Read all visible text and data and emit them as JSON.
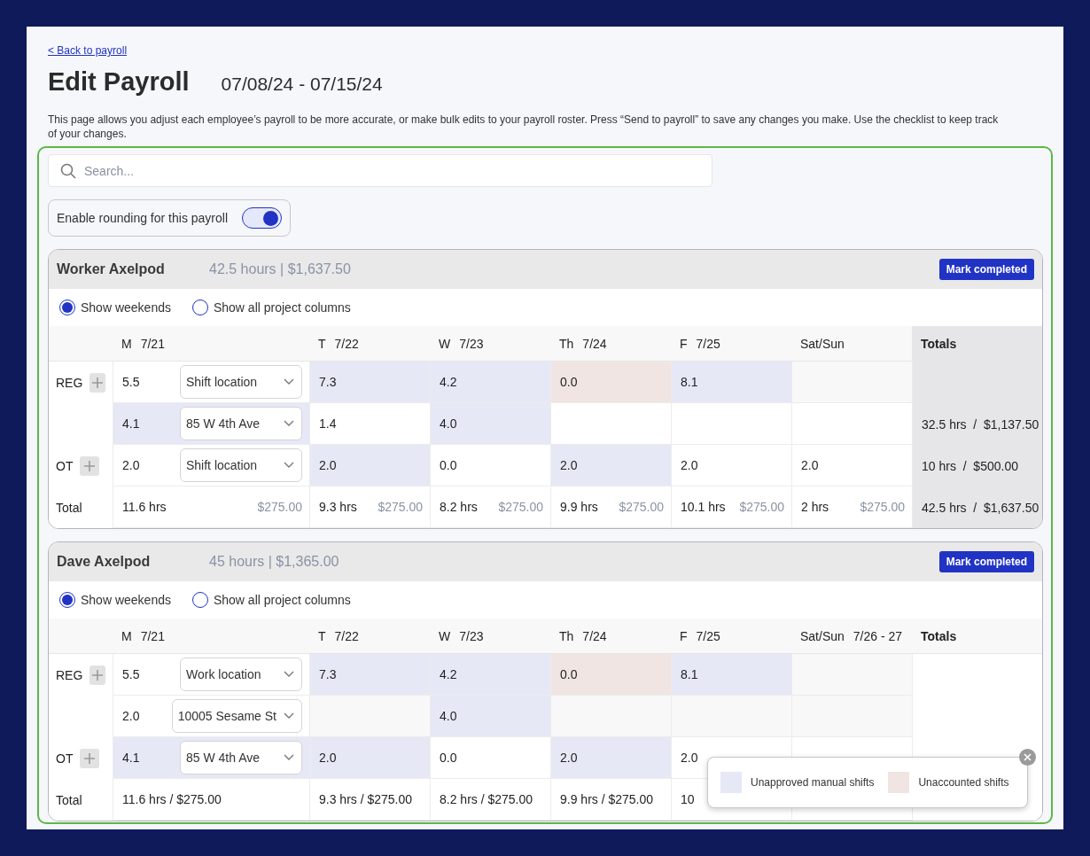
{
  "back_link": "< Back to payroll",
  "title": "Edit Payroll",
  "date_range": "07/08/24 - 07/15/24",
  "description": "This page allows you adjust each employee’s payroll to be more accurate, or make bulk edits to your payroll roster. Press “Send to payroll”  to save any changes you make. Use the checklist to keep track of your changes.",
  "search": {
    "placeholder": "Search..."
  },
  "rounding_toggle": {
    "label": "Enable rounding for this payroll",
    "on": true
  },
  "employees": [
    {
      "name": "Worker Axelpod",
      "summary": "42.5 hours | $1,637.50",
      "button": "Mark completed",
      "totals_shaded": true,
      "options": [
        {
          "label": "Show weekends",
          "selected": true
        },
        {
          "label": "Show all project columns",
          "selected": false
        }
      ],
      "columns": [
        {
          "day": "M",
          "date": "7/21"
        },
        {
          "day": "T",
          "date": "7/22"
        },
        {
          "day": "W",
          "date": "7/23"
        },
        {
          "day": "Th",
          "date": "7/24"
        },
        {
          "day": "F",
          "date": "7/25"
        },
        {
          "day": "Sat/Sun"
        },
        {
          "day": "Totals"
        }
      ],
      "rows": [
        {
          "label": "REG",
          "monday": {
            "value": "5.5",
            "location": "Shift location",
            "color": "#ffffff"
          },
          "days": [
            {
              "value": "7.3",
              "color": "#e6e8f6"
            },
            {
              "value": "4.2",
              "color": "#e6e8f6"
            },
            {
              "value": "0.0",
              "color": "#f1e5e3"
            },
            {
              "value": "8.1",
              "color": "#e6e8f6"
            },
            {
              "color": "#f8f8f8"
            }
          ]
        },
        {
          "monday": {
            "value": "4.1",
            "location": "85 W 4th Ave",
            "color": "#e6e8f6"
          },
          "days": [
            {
              "value": "1.4",
              "color": "#ffffff"
            },
            {
              "value": "4.0",
              "color": "#e6e8f6"
            },
            {
              "color": "#ffffff"
            },
            {
              "color": "#ffffff"
            },
            {
              "color": "#ffffff"
            }
          ],
          "total": "32.5 hrs  /  $1,137.50"
        },
        {
          "label": "OT",
          "monday": {
            "value": "2.0",
            "location": "Shift location",
            "color": "#ffffff"
          },
          "days": [
            {
              "value": "2.0",
              "color": "#e6e8f6"
            },
            {
              "value": "0.0",
              "color": "#ffffff"
            },
            {
              "value": "2.0",
              "color": "#e6e8f6"
            },
            {
              "value": "2.0",
              "color": "#ffffff"
            },
            {
              "value": "2.0",
              "color": "#ffffff"
            }
          ],
          "total": "10 hrs  /  $500.00"
        }
      ],
      "total_row": {
        "label": "Total",
        "cells": [
          {
            "hours": "11.6 hrs",
            "amount": "$275.00"
          },
          {
            "hours": "9.3 hrs",
            "amount": "$275.00"
          },
          {
            "hours": "8.2 hrs",
            "amount": "$275.00"
          },
          {
            "hours": "9.9 hrs",
            "amount": "$275.00"
          },
          {
            "hours": "10.1 hrs",
            "amount": "$275.00"
          },
          {
            "hours": "2 hrs",
            "amount": "$275.00"
          }
        ],
        "total": "42.5 hrs  /  $1,637.50"
      }
    },
    {
      "name": "Dave Axelpod",
      "summary": "45 hours | $1,365.00",
      "button": "Mark completed",
      "totals_shaded": false,
      "options": [
        {
          "label": "Show weekends",
          "selected": true
        },
        {
          "label": "Show all project columns",
          "selected": false
        }
      ],
      "columns": [
        {
          "day": "M",
          "date": "7/21"
        },
        {
          "day": "T",
          "date": "7/22"
        },
        {
          "day": "W",
          "date": "7/23"
        },
        {
          "day": "Th",
          "date": "7/24"
        },
        {
          "day": "F",
          "date": "7/25"
        },
        {
          "day": "Sat/Sun",
          "date": "7/26 - 27"
        },
        {
          "day": "Totals"
        }
      ],
      "rows": [
        {
          "label": "REG",
          "monday": {
            "value": "5.5",
            "location": "Work location",
            "color": "#ffffff"
          },
          "days": [
            {
              "value": "7.3",
              "color": "#e6e8f6"
            },
            {
              "value": "4.2",
              "color": "#e6e8f6"
            },
            {
              "value": "0.0",
              "color": "#f1e5e3"
            },
            {
              "value": "8.1",
              "color": "#e6e8f6"
            },
            {
              "color": "#f8f8f8"
            }
          ]
        },
        {
          "monday": {
            "value": "2.0",
            "location": "10005 Sesame St",
            "color": "#ffffff"
          },
          "days": [
            {
              "color": "#f8f8f8"
            },
            {
              "value": "4.0",
              "color": "#e6e8f6"
            },
            {
              "color": "#f8f8f8"
            },
            {
              "color": "#f8f8f8"
            },
            {
              "color": "#f8f8f8"
            }
          ]
        },
        {
          "label": "OT",
          "monday": {
            "value": "4.1",
            "location": "85 W 4th Ave",
            "color": "#e6e8f6"
          },
          "days": [
            {
              "value": "2.0",
              "color": "#e6e8f6"
            },
            {
              "value": "0.0",
              "color": "#ffffff"
            },
            {
              "value": "2.0",
              "color": "#e6e8f6"
            },
            {
              "value": "2.0",
              "color": "#ffffff"
            },
            {
              "color": "#ffffff"
            }
          ]
        }
      ],
      "total_row": {
        "label": "Total",
        "cells": [
          {
            "text": "11.6 hrs / $275.00"
          },
          {
            "text": "9.3 hrs / $275.00"
          },
          {
            "text": "8.2 hrs / $275.00"
          },
          {
            "text": "9.9 hrs / $275.00"
          },
          {
            "text": "10"
          },
          {}
        ]
      },
      "legend": [
        {
          "label": "Unapproved manual shifts",
          "color": "#e6e8f6"
        },
        {
          "label": "Unaccounted shifts",
          "color": "#f1e5e3"
        }
      ]
    }
  ]
}
